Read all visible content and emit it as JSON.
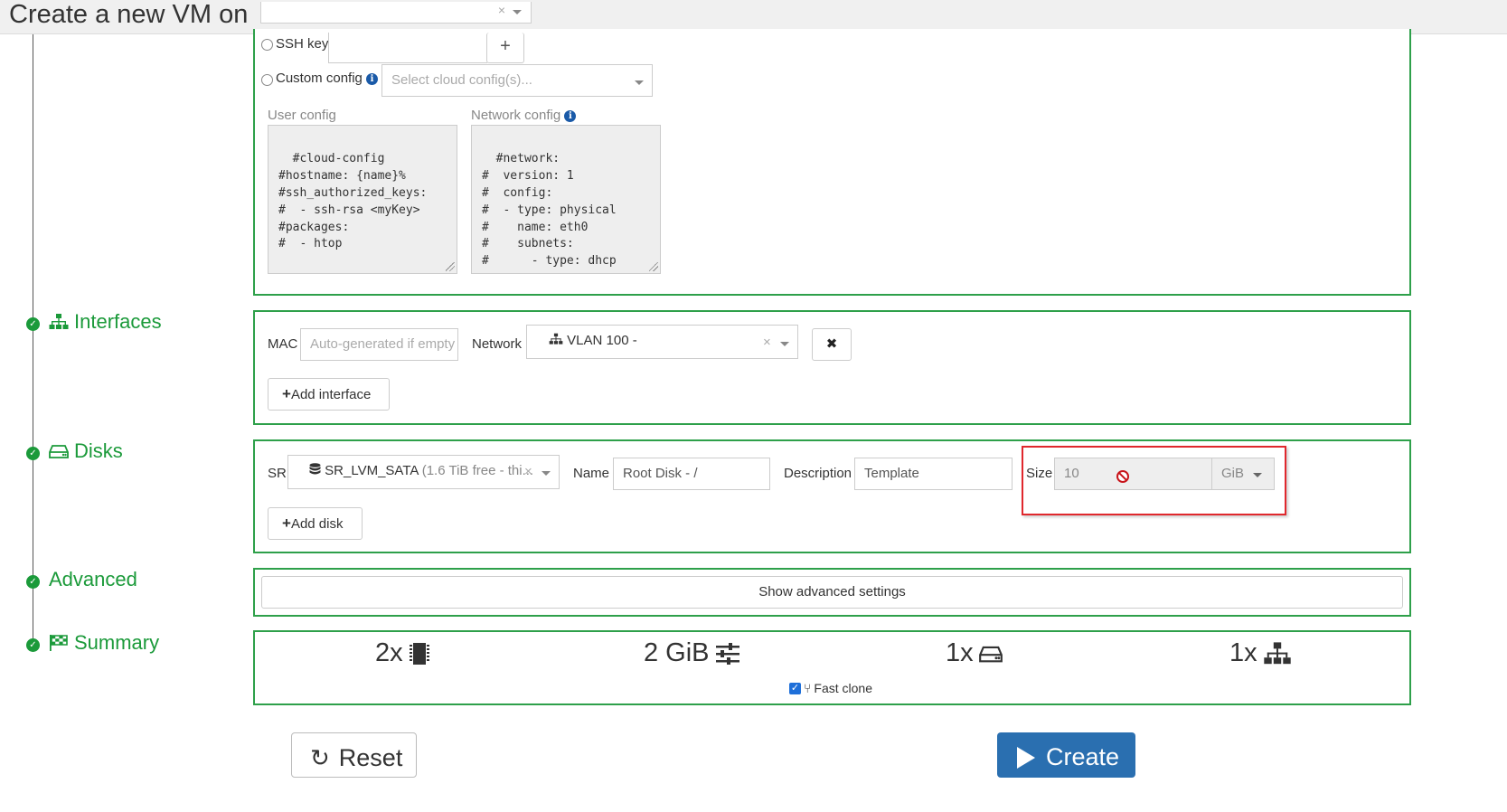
{
  "header": {
    "title": "Create a new VM on",
    "pool_select_clear": "×"
  },
  "steps": {
    "interfaces": "Interfaces",
    "disks": "Disks",
    "advanced": "Advanced",
    "summary": "Summary"
  },
  "install": {
    "ssh_key_label": "SSH key",
    "add_ssh_key_button": "+",
    "custom_config_label": "Custom config",
    "cloud_config_placeholder": "Select cloud config(s)...",
    "user_config_label": "User config",
    "network_config_label": "Network config",
    "user_config_value": "#cloud-config\n#hostname: {name}%\n#ssh_authorized_keys:\n#  - ssh-rsa <myKey>\n#packages:\n#  - htop",
    "network_config_value": "#network:\n#  version: 1\n#  config:\n#  - type: physical\n#    name: eth0\n#    subnets:\n#      - type: dhcp"
  },
  "interfaces": {
    "mac_label": "MAC",
    "mac_placeholder": "Auto-generated if empty",
    "network_label": "Network",
    "network_value": "VLAN 100 -",
    "clear": "×",
    "remove_button": "✖",
    "add_interface_button": "Add interface"
  },
  "disks": {
    "sr_label": "SR",
    "sr_name": "SR_LVM_SATA",
    "sr_detail": "(1.6 TiB free - thi...",
    "clear": "×",
    "name_label": "Name",
    "name_value": "Root Disk - /",
    "description_label": "Description",
    "description_value": "Template",
    "size_label": "Size",
    "size_value": "10",
    "size_unit": "GiB",
    "add_disk_button": "Add disk"
  },
  "advanced": {
    "show_button": "Show advanced settings"
  },
  "summary": {
    "cpus": "2x",
    "memory": "2 GiB",
    "disks": "1x",
    "interfaces": "1x",
    "fast_clone_label": "Fast clone",
    "fast_clone_checked": true
  },
  "footer": {
    "reset_button": "Reset",
    "create_button": "Create"
  },
  "colors": {
    "accent_green": "#2ea04a",
    "primary_blue": "#2a6fb0",
    "highlight_red": "#e0282d"
  }
}
